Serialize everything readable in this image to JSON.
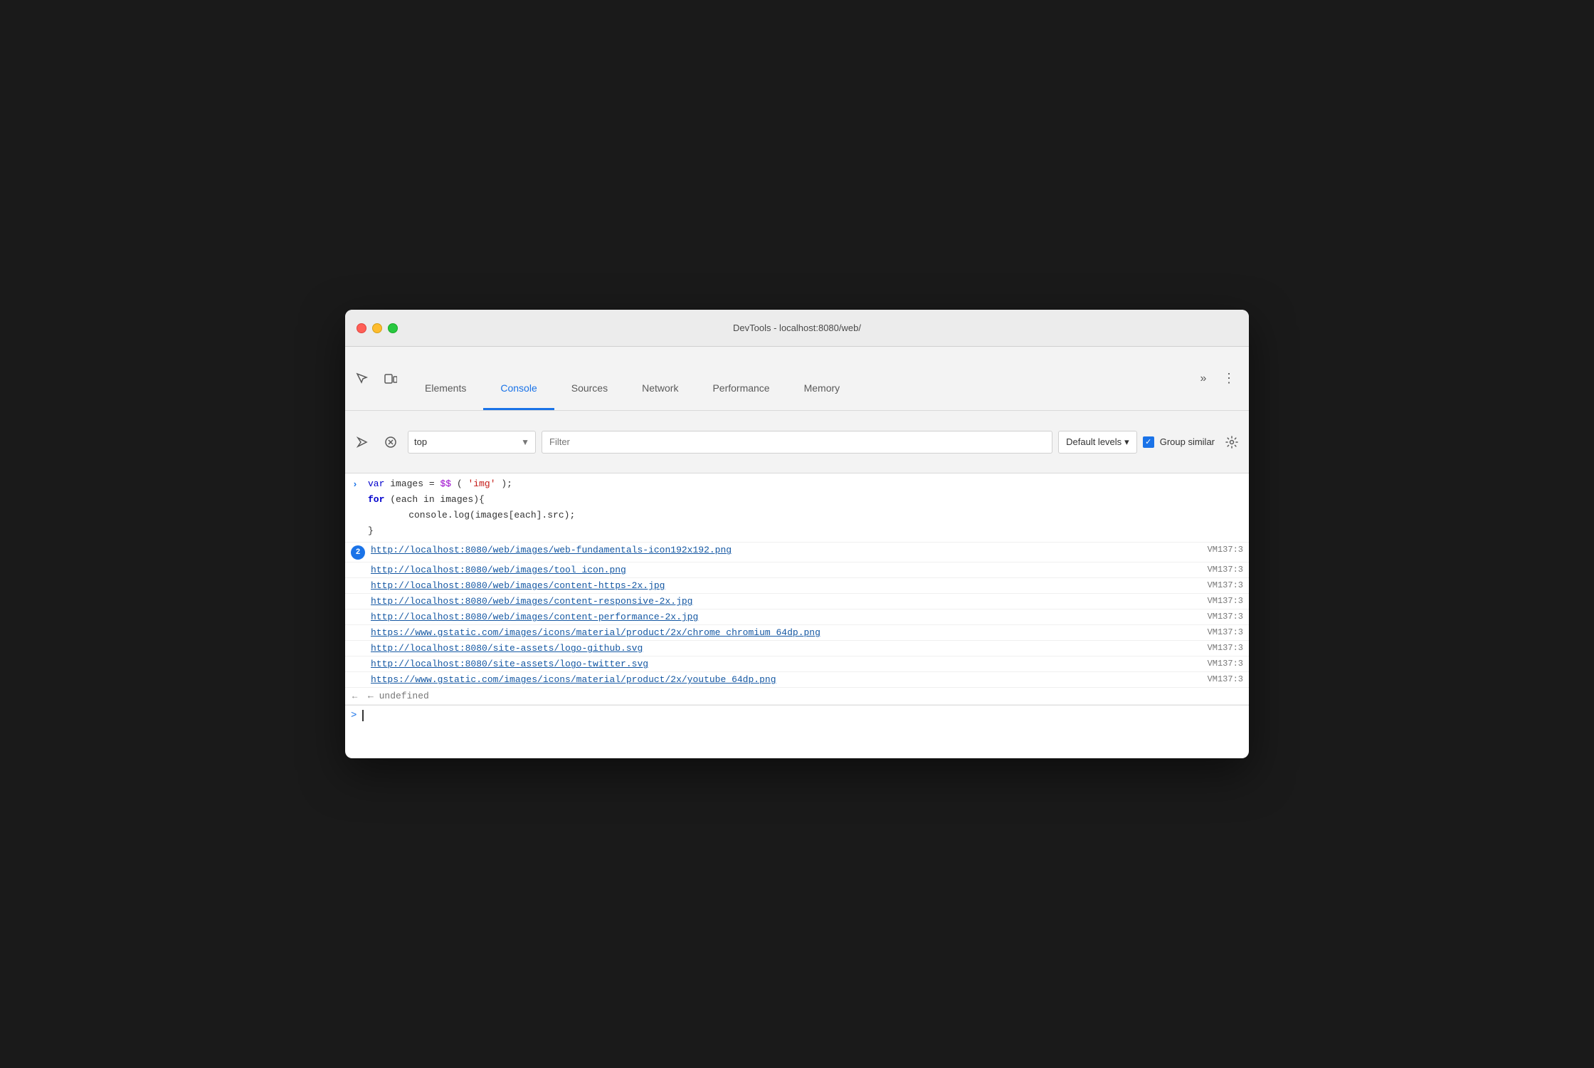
{
  "window": {
    "title": "DevTools - localhost:8080/web/"
  },
  "tabs": [
    {
      "id": "elements",
      "label": "Elements",
      "active": false
    },
    {
      "id": "console",
      "label": "Console",
      "active": true
    },
    {
      "id": "sources",
      "label": "Sources",
      "active": false
    },
    {
      "id": "network",
      "label": "Network",
      "active": false
    },
    {
      "id": "performance",
      "label": "Performance",
      "active": false
    },
    {
      "id": "memory",
      "label": "Memory",
      "active": false
    }
  ],
  "toolbar": {
    "context_value": "top",
    "context_dropdown_symbol": "▼",
    "filter_placeholder": "Filter",
    "levels_label": "Default levels",
    "levels_dropdown_symbol": "▾",
    "group_similar_label": "Group similar",
    "group_similar_checked": true
  },
  "console": {
    "code_lines": [
      {
        "type": "keyword",
        "parts": [
          {
            "t": "var",
            "cls": "keyword"
          },
          {
            "t": " images = ",
            "cls": "plain"
          },
          {
            "t": "$$",
            "cls": "func"
          },
          {
            "t": "(",
            "cls": "plain"
          },
          {
            "t": "'img'",
            "cls": "string"
          },
          {
            "t": ");",
            "cls": "plain"
          }
        ]
      },
      {
        "type": "plain",
        "parts": [
          {
            "t": "for",
            "cls": "keyword"
          },
          {
            "t": " (each in images){",
            "cls": "plain"
          }
        ]
      },
      {
        "type": "plain",
        "parts": [
          {
            "t": "        console.log(images[each].src);",
            "cls": "plain"
          }
        ]
      },
      {
        "type": "plain",
        "parts": [
          {
            "t": "}",
            "cls": "plain"
          }
        ]
      }
    ],
    "log_entries": [
      {
        "badge": "2",
        "url": "http://localhost:8080/web/images/web-fundamentals-icon192x192.png",
        "source": "VM137:3",
        "wrap": false
      },
      {
        "badge": null,
        "url": "http://localhost:8080/web/images/tool_icon.png",
        "source": "VM137:3",
        "wrap": false
      },
      {
        "badge": null,
        "url": "http://localhost:8080/web/images/content-https-2x.jpg",
        "source": "VM137:3",
        "wrap": false
      },
      {
        "badge": null,
        "url": "http://localhost:8080/web/images/content-responsive-2x.jpg",
        "source": "VM137:3",
        "wrap": false
      },
      {
        "badge": null,
        "url": "http://localhost:8080/web/images/content-performance-2x.jpg",
        "source": "VM137:3",
        "wrap": false
      },
      {
        "badge": null,
        "url": "https://www.gstatic.com/images/icons/material/product/2x/chrome_chromium_64dp.png",
        "source": "VM137:3",
        "wrap": true
      },
      {
        "badge": null,
        "url": "http://localhost:8080/site-assets/logo-github.svg",
        "source": "VM137:3",
        "wrap": false
      },
      {
        "badge": null,
        "url": "http://localhost:8080/site-assets/logo-twitter.svg",
        "source": "VM137:3",
        "wrap": false
      },
      {
        "badge": null,
        "url": "https://www.gstatic.com/images/icons/material/product/2x/youtube_64dp.png",
        "source": "VM137:3",
        "wrap": true
      }
    ],
    "undefined_text": "← undefined",
    "input_prompt": ">"
  }
}
